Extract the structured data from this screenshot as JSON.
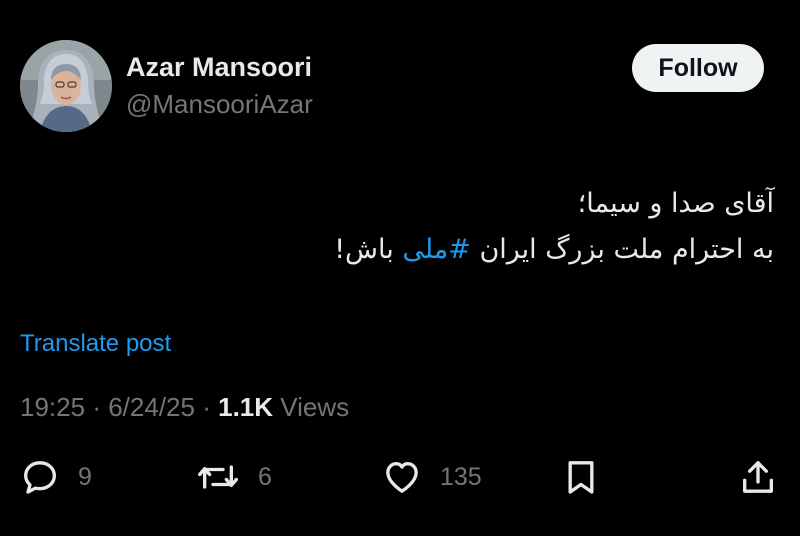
{
  "author": {
    "display_name": "Azar Mansoori",
    "handle": "@MansooriAzar"
  },
  "follow_button": {
    "label": "Follow"
  },
  "tweet": {
    "line1": "آقای صدا و سیما؛",
    "line2_before_hashtag": "به احترام ملت بزرگ ایران",
    "hashtag": "#ملی",
    "line2_after_hashtag": "باش!"
  },
  "translate": {
    "label": "Translate post"
  },
  "meta": {
    "time": "19:25",
    "separator": "·",
    "date": "6/24/25",
    "views_count": "1.1K",
    "views_label": "Views"
  },
  "actions": {
    "reply_count": "9",
    "repost_count": "6",
    "like_count": "135"
  },
  "icons": {
    "reply": "speech-bubble-icon",
    "repost": "repost-arrows-icon",
    "like": "heart-icon",
    "bookmark": "bookmark-icon",
    "share": "share-upload-icon"
  },
  "colors": {
    "background": "#000000",
    "text_primary": "#e7e9ea",
    "text_secondary": "#71767b",
    "accent_link": "#1d9bf0",
    "follow_button_bg": "#eff3f4"
  }
}
